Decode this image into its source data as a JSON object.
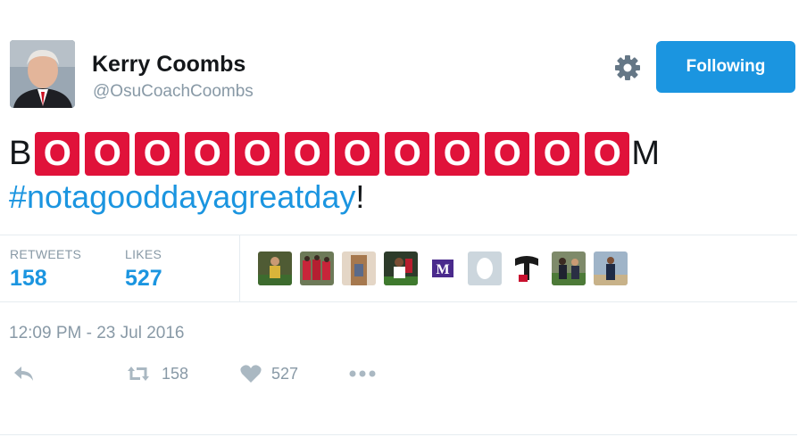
{
  "user": {
    "name": "Kerry Coombs",
    "handle": "@OsuCoachCoombs"
  },
  "follow_button": {
    "label": "Following"
  },
  "tweet": {
    "prefix": "B",
    "letters": [
      "O",
      "O",
      "O",
      "O",
      "O",
      "O",
      "O",
      "O",
      "O",
      "O",
      "O",
      "O"
    ],
    "suffix": "M",
    "hashtag": "#notagooddayagreatday",
    "after_hashtag": "!"
  },
  "stats": {
    "retweets_label": "RETWEETS",
    "retweets_value": "158",
    "likes_label": "LIKES",
    "likes_value": "527"
  },
  "timestamp": "12:09 PM - 23 Jul 2016",
  "actions": {
    "retweet_count": "158",
    "like_count": "527"
  },
  "colors": {
    "accent": "#1b95e0",
    "tile": "#e0123a",
    "muted": "#8899a6"
  }
}
